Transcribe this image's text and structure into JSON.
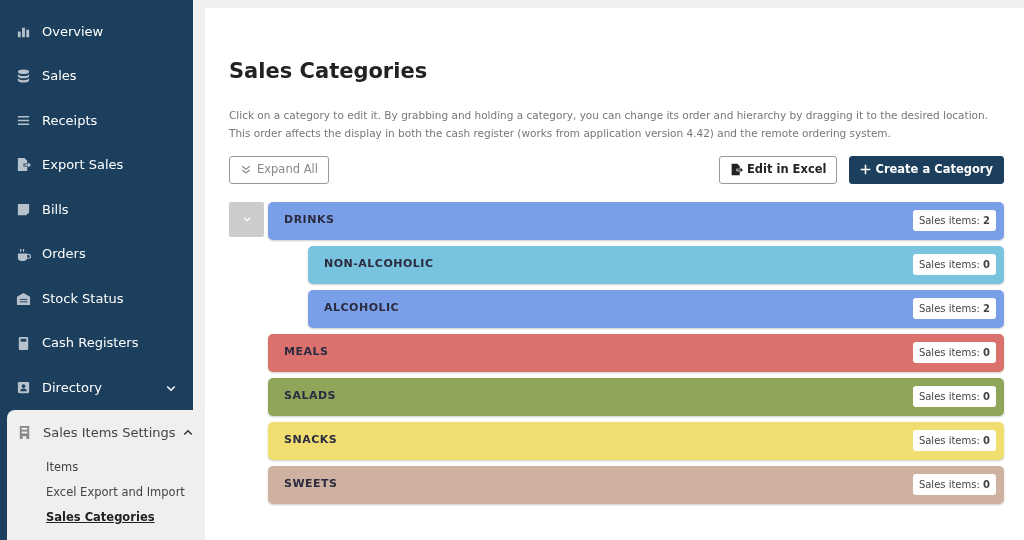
{
  "sidebar": {
    "items": [
      {
        "label": "Overview",
        "kind": "link"
      },
      {
        "label": "Sales",
        "kind": "link"
      },
      {
        "label": "Receipts",
        "kind": "link"
      },
      {
        "label": "Export Sales",
        "kind": "link"
      },
      {
        "label": "Bills",
        "kind": "link"
      },
      {
        "label": "Orders",
        "kind": "link"
      },
      {
        "label": "Stock Status",
        "kind": "link"
      },
      {
        "label": "Cash Registers",
        "kind": "link"
      },
      {
        "label": "Directory",
        "kind": "group",
        "expanded": false
      },
      {
        "label": "Sales Items Settings",
        "kind": "group",
        "expanded": true,
        "children": [
          {
            "label": "Items",
            "selected": false
          },
          {
            "label": "Excel Export and Import",
            "selected": false
          },
          {
            "label": "Sales Categories",
            "selected": true
          }
        ]
      }
    ]
  },
  "page": {
    "title": "Sales Categories",
    "description": "Click on a category to edit it. By grabbing and holding a category, you can change its order and hierarchy by dragging it to the desired location. This order affects the display in both the cash register (works from application version 4.42) and the remote ordering system.",
    "buttons": [
      {
        "label": "Expand All",
        "kind": "expand"
      },
      {
        "label": "Edit in Excel",
        "kind": "excel"
      },
      {
        "label": "Create a Category",
        "kind": "create"
      }
    ]
  },
  "categories": [
    {
      "name": "DRINKS",
      "count": "Sales items: **2**",
      "color": "#789fe8",
      "expanded": true,
      "children": [
        {
          "name": "NON-ALCOHOLIC",
          "count": "Sales items: **0**",
          "color": "#78c3dd"
        },
        {
          "name": "ALCOHOLIC",
          "count": "Sales items: **2**",
          "color": "#789fe8"
        }
      ]
    },
    {
      "name": "MEALS",
      "count": "Sales items: **0**",
      "color": "#da716d"
    },
    {
      "name": "SALADS",
      "count": "Sales items: **0**",
      "color": "#8fa65a"
    },
    {
      "name": "SNACKS",
      "count": "Sales items: **0**",
      "color": "#f0de70"
    },
    {
      "name": "SWEETS",
      "count": "Sales items: **0**",
      "color": "#cfb1a2"
    }
  ]
}
